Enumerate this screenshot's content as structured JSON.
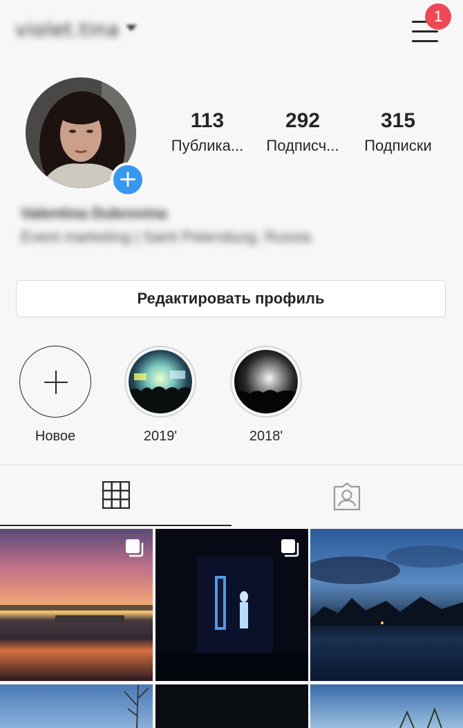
{
  "header": {
    "username": "violet.tina",
    "notification_count": "1"
  },
  "profile": {
    "stats": [
      {
        "value": "113",
        "label": "Публика..."
      },
      {
        "value": "292",
        "label": "Подписч..."
      },
      {
        "value": "315",
        "label": "Подписки"
      }
    ],
    "bio_name": "Valentina Dubrovina",
    "bio_text": "Event marketing | Saint Petersburg, Russia",
    "edit_button_label": "Редактировать профиль"
  },
  "highlights": [
    {
      "label": "Новое"
    },
    {
      "label": "2019'"
    },
    {
      "label": "2018'"
    }
  ],
  "tabs": [
    {
      "icon": "grid-icon",
      "active": true
    },
    {
      "icon": "tagged-person-icon",
      "active": false
    }
  ],
  "colors": {
    "accent": "#3897f0",
    "badge": "#ed4956",
    "text": "#262626",
    "background": "#f7f7f7"
  }
}
